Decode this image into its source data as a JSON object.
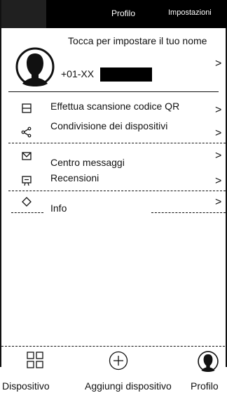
{
  "header": {
    "tabs": [
      {
        "label": "Profilo"
      },
      {
        "label": "Impostazioni"
      }
    ]
  },
  "profile": {
    "name_prompt": "Tocca per impostare il tuo nome",
    "phone": "+01-XX",
    "avatar_icon": "user-avatar-icon"
  },
  "menu": {
    "items": [
      {
        "label": "Effettua scansione codice QR",
        "icon": "qr-scan-icon"
      },
      {
        "label": "Condivisione dei dispositivi",
        "icon": "share-icon"
      },
      {
        "label": "Centro messaggi",
        "icon": "mail-icon"
      },
      {
        "label": "Recensioni",
        "icon": "review-icon"
      },
      {
        "label": "Info",
        "icon": "info-diamond-icon"
      }
    ],
    "chevron": ">"
  },
  "bottom_nav": {
    "items": [
      {
        "label": "Dispositivo",
        "icon": "grid-icon"
      },
      {
        "label": "Aggiungi dispositivo",
        "icon": "add-circle-icon"
      },
      {
        "label": "Profilo",
        "icon": "user-avatar-icon"
      }
    ]
  }
}
